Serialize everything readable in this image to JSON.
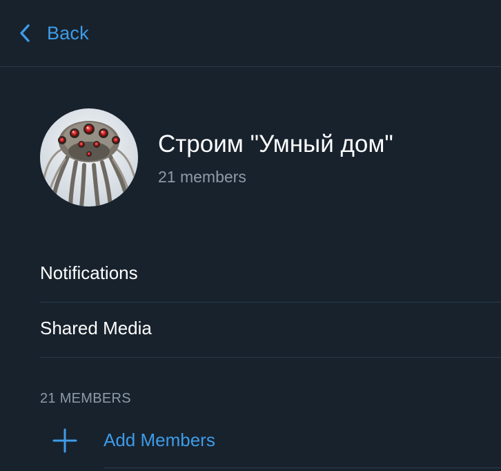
{
  "navbar": {
    "back_label": "Back",
    "back_icon": "chevron-left-icon"
  },
  "group": {
    "title": "Строим \"Умный дом\"",
    "subtitle": "21 members",
    "avatar_icon": "group-avatar-image"
  },
  "menu": {
    "items": [
      {
        "label": "Notifications"
      },
      {
        "label": "Shared Media"
      }
    ]
  },
  "members_section": {
    "header": "21 MEMBERS",
    "add_label": "Add Members",
    "add_icon": "plus-icon"
  },
  "colors": {
    "background": "#18222D",
    "accent": "#3E9CE8",
    "secondary_text": "#8E9BA8",
    "divider": "#2A3A4A"
  }
}
